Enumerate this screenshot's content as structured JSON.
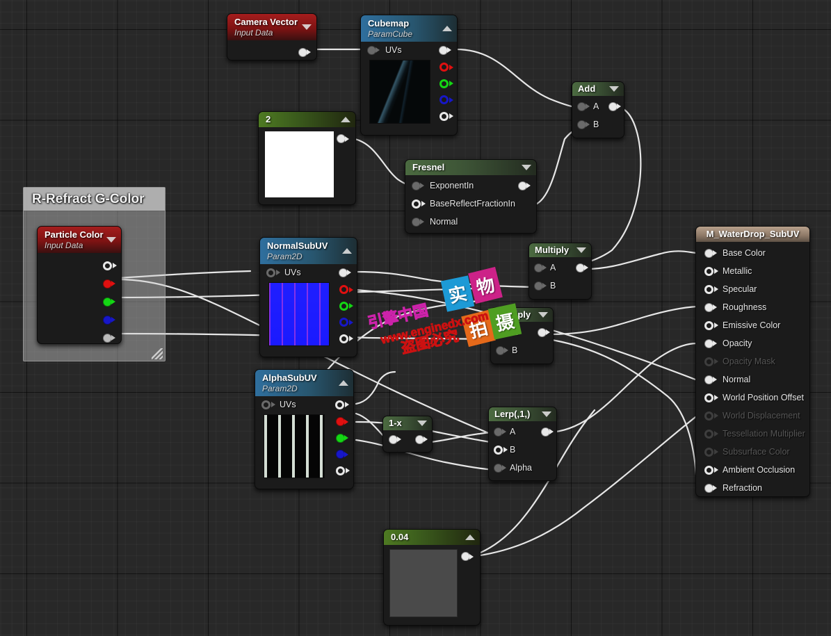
{
  "app": {
    "title": "Unreal Engine Material Editor Graph",
    "background_color": "#282828"
  },
  "comment": {
    "title": "R-Refract G-Color"
  },
  "nodes": {
    "camera_vector": {
      "title": "Camera Vector",
      "subtitle": "Input Data",
      "outputs": [
        {
          "label": ""
        }
      ]
    },
    "cubemap": {
      "title": "Cubemap",
      "subtitle": "ParamCube",
      "inputs": [
        {
          "label": "UVs"
        }
      ],
      "outputs": [
        {
          "label": "",
          "channel": "rgb"
        },
        {
          "label": "",
          "channel": "r"
        },
        {
          "label": "",
          "channel": "g"
        },
        {
          "label": "",
          "channel": "b"
        },
        {
          "label": "",
          "channel": "a"
        }
      ]
    },
    "const_two": {
      "title": "2"
    },
    "fresnel": {
      "title": "Fresnel",
      "inputs": [
        {
          "label": "ExponentIn"
        },
        {
          "label": "BaseReflectFractionIn"
        },
        {
          "label": "Normal"
        }
      ],
      "outputs": [
        {
          "label": ""
        }
      ]
    },
    "add": {
      "title": "Add",
      "inputs": [
        {
          "label": "A"
        },
        {
          "label": "B"
        }
      ],
      "outputs": [
        {
          "label": ""
        }
      ]
    },
    "particle_color": {
      "title": "Particle Color",
      "subtitle": "Input Data",
      "outputs": [
        {
          "label": "",
          "channel": "rgb"
        },
        {
          "label": "",
          "channel": "r"
        },
        {
          "label": "",
          "channel": "g"
        },
        {
          "label": "",
          "channel": "b"
        },
        {
          "label": "",
          "channel": "a"
        }
      ]
    },
    "normal_subuv": {
      "title": "NormalSubUV",
      "subtitle": "Param2D",
      "inputs": [
        {
          "label": "UVs"
        }
      ],
      "outputs": [
        {
          "label": "",
          "channel": "rgb"
        },
        {
          "label": "",
          "channel": "r"
        },
        {
          "label": "",
          "channel": "g"
        },
        {
          "label": "",
          "channel": "b"
        },
        {
          "label": "",
          "channel": "a"
        }
      ]
    },
    "alpha_subuv": {
      "title": "AlphaSubUV",
      "subtitle": "Param2D",
      "inputs": [
        {
          "label": "UVs"
        }
      ],
      "outputs": [
        {
          "label": "",
          "channel": "rgb"
        },
        {
          "label": "",
          "channel": "r"
        },
        {
          "label": "",
          "channel": "g"
        },
        {
          "label": "",
          "channel": "b"
        },
        {
          "label": "",
          "channel": "a"
        }
      ]
    },
    "multiply_top": {
      "title": "Multiply",
      "inputs": [
        {
          "label": "A"
        },
        {
          "label": "B"
        }
      ],
      "outputs": [
        {
          "label": ""
        }
      ]
    },
    "multiply_bottom": {
      "title": "Multiply",
      "inputs": [
        {
          "label": "A"
        },
        {
          "label": "B"
        }
      ],
      "outputs": [
        {
          "label": ""
        }
      ]
    },
    "one_minus_x": {
      "title": "1-x"
    },
    "lerp": {
      "title": "Lerp(,1,)",
      "inputs": [
        {
          "label": "A"
        },
        {
          "label": "B"
        },
        {
          "label": "Alpha"
        }
      ],
      "outputs": [
        {
          "label": ""
        }
      ]
    },
    "const_004": {
      "title": "0.04"
    },
    "material_output": {
      "title": "M_WaterDrop_SubUV",
      "inputs": [
        {
          "label": "Base Color",
          "connected": true,
          "enabled": true
        },
        {
          "label": "Metallic",
          "connected": false,
          "enabled": true
        },
        {
          "label": "Specular",
          "connected": false,
          "enabled": true
        },
        {
          "label": "Roughness",
          "connected": true,
          "enabled": true
        },
        {
          "label": "Emissive Color",
          "connected": false,
          "enabled": true
        },
        {
          "label": "Opacity",
          "connected": true,
          "enabled": true
        },
        {
          "label": "Opacity Mask",
          "connected": false,
          "enabled": false
        },
        {
          "label": "Normal",
          "connected": true,
          "enabled": true
        },
        {
          "label": "World Position Offset",
          "connected": false,
          "enabled": true
        },
        {
          "label": "World Displacement",
          "connected": false,
          "enabled": false
        },
        {
          "label": "Tessellation Multiplier",
          "connected": false,
          "enabled": false
        },
        {
          "label": "Subsurface Color",
          "connected": false,
          "enabled": false
        },
        {
          "label": "Ambient Occlusion",
          "connected": false,
          "enabled": true
        },
        {
          "label": "Refraction",
          "connected": true,
          "enabled": true
        }
      ]
    }
  },
  "watermark": {
    "blocks": [
      {
        "text": "实",
        "color": "#1d9ad6"
      },
      {
        "text": "物",
        "color": "#cc2288"
      },
      {
        "text": "拍",
        "color": "#e5691a"
      },
      {
        "text": "摄",
        "color": "#4f9e22"
      }
    ],
    "line1": "引擎中国",
    "line2": "www.enginedx.com",
    "line3": "盗图必究",
    "line1_color": "#cc22aa",
    "line2_color": "#cc1111",
    "line3_color": "#cc1111"
  }
}
